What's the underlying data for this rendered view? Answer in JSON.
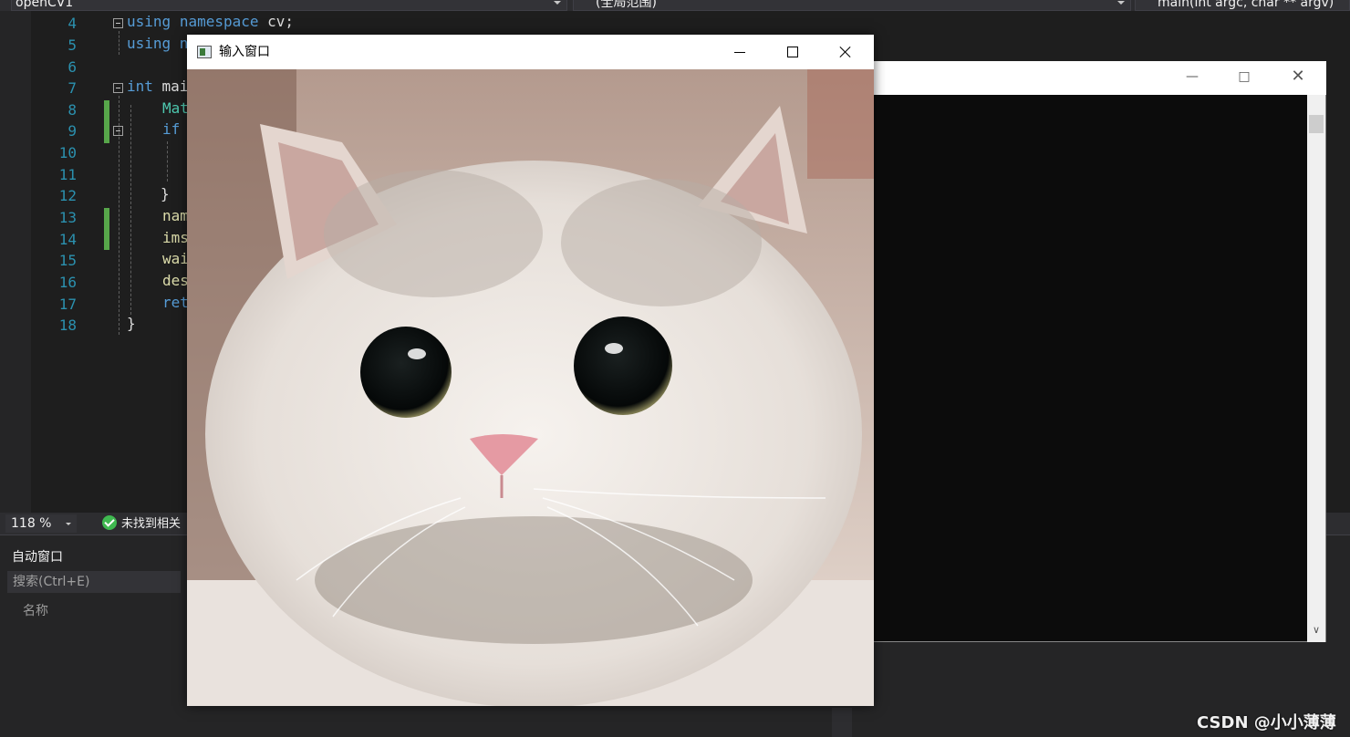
{
  "toolbar": {
    "project_combo": "openCV1",
    "scope_combo": "(全局范围)",
    "member_combo": "main(int argc, char ** argv)"
  },
  "editor": {
    "line_numbers": [
      "4",
      "5",
      "6",
      "7",
      "8",
      "9",
      "10",
      "11",
      "12",
      "13",
      "14",
      "15",
      "16",
      "17",
      "18"
    ],
    "lines": {
      "l4": {
        "kw1": "using",
        "kw2": "namespace",
        "rest": " cv;"
      },
      "l5": {
        "kw1": "using",
        "rest": " n"
      },
      "l7": {
        "kw1": "int",
        "rest": " mai"
      },
      "l8": {
        "ty": "Mat"
      },
      "l9": {
        "kw1": "if"
      },
      "l12": {
        "rest": "}"
      },
      "l13": {
        "fn": "nam"
      },
      "l14": {
        "fn": "ims"
      },
      "l15": {
        "fn": "wai"
      },
      "l16": {
        "fn": "des"
      },
      "l17": {
        "kw1": "ret"
      },
      "l18": {
        "rest": "}"
      }
    }
  },
  "status": {
    "zoom": "118 %",
    "issues": "未找到相关"
  },
  "auto_window": {
    "title": "自动窗口",
    "search_placeholder": "搜索(Ctrl+E)",
    "column_name": "名称"
  },
  "image_window": {
    "title": "输入窗口"
  },
  "watermark": "CSDN @小小薄薄",
  "colors": {
    "editor_bg": "#1e1e1e",
    "keyword": "#569cd6",
    "type": "#4ec9b0",
    "function": "#dcdcaa",
    "line_number": "#2b91af",
    "change_marker": "#57a64a"
  }
}
